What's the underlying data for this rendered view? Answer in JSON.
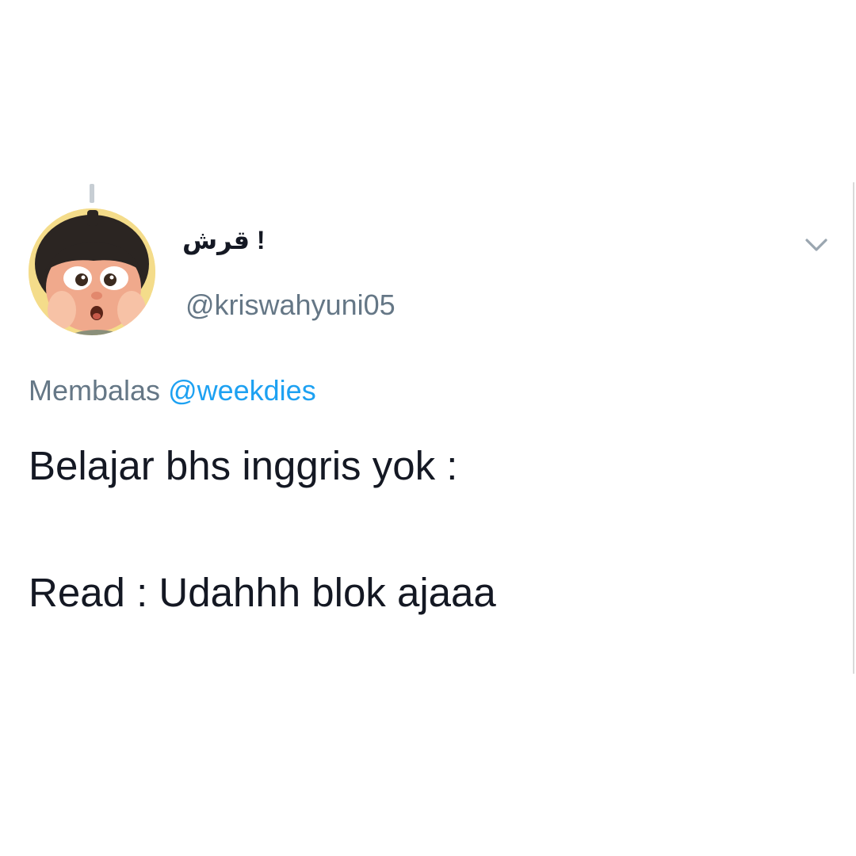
{
  "tweet": {
    "author": {
      "display_name": "قرش !",
      "handle": "@kriswahyuni05",
      "avatar_icon": "avatar-cartoon-girl-icon"
    },
    "menu_icon": "chevron-down-icon",
    "reply": {
      "prefix": "Membalas ",
      "mention": "@weekdies"
    },
    "text_lines": [
      "Belajar bhs inggris yok :",
      "Read : Udahhh blok ajaaa"
    ]
  },
  "colors": {
    "text": "#141823",
    "secondary": "#657786",
    "link": "#1da1f2",
    "thread_line": "#c7ced4"
  }
}
